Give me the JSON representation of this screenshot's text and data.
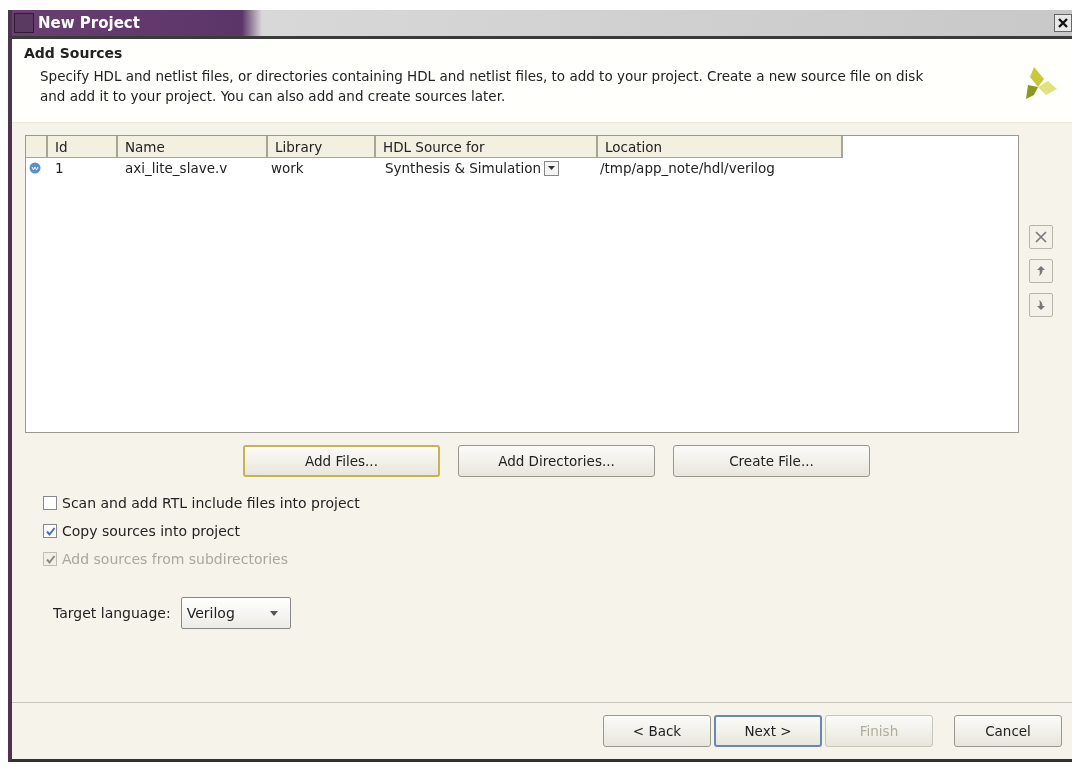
{
  "window": {
    "title": "New Project"
  },
  "header": {
    "title": "Add Sources",
    "description": "Specify HDL and netlist files, or directories containing HDL and netlist files, to add to your project. Create a new source file on disk and add it to your project. You can also add and create sources later."
  },
  "table": {
    "columns": [
      "Id",
      "Name",
      "Library",
      "HDL Source for",
      "Location"
    ],
    "rows": [
      {
        "id": "1",
        "name": "axi_lite_slave.v",
        "library": "work",
        "hdl_source_for": "Synthesis & Simulation",
        "location": "/tmp/app_note/hdl/verilog",
        "selected": false
      }
    ]
  },
  "side_buttons": [
    {
      "kind": "remove",
      "disabled": true
    },
    {
      "kind": "up",
      "disabled": true
    },
    {
      "kind": "down",
      "disabled": true
    }
  ],
  "add_buttons": [
    {
      "label": "Add Files...",
      "focused": true
    },
    {
      "label": "Add Directories...",
      "focused": false
    },
    {
      "label": "Create File...",
      "focused": false
    }
  ],
  "options": [
    {
      "label": "Scan and add RTL include files into project",
      "checked": false,
      "disabled": false
    },
    {
      "label": "Copy sources into project",
      "checked": true,
      "disabled": false
    },
    {
      "label": "Add sources from subdirectories",
      "checked": true,
      "disabled": true
    }
  ],
  "target_language": {
    "label": "Target language:",
    "value": "Verilog"
  },
  "nav_buttons": [
    {
      "label": "< Back",
      "disabled": false,
      "focused": false
    },
    {
      "label": "Next >",
      "disabled": false,
      "focused": true
    },
    {
      "label": "Finish",
      "disabled": true,
      "focused": false
    },
    {
      "label": "Cancel",
      "disabled": false,
      "focused": false
    }
  ]
}
